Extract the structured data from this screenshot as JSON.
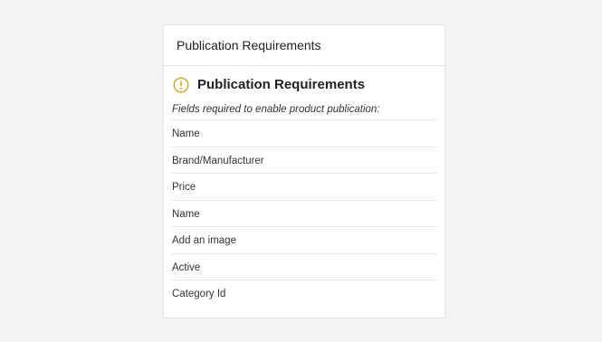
{
  "panel": {
    "header_title": "Publication Requirements",
    "section_title": "Publication Requirements",
    "subtitle": "Fields required to enable product publication:",
    "icon": "warning-circle-icon",
    "accent_color": "#d9a21b"
  },
  "requirements": [
    {
      "label": "Name"
    },
    {
      "label": "Brand/Manufacturer"
    },
    {
      "label": "Price"
    },
    {
      "label": "Name"
    },
    {
      "label": "Add an image"
    },
    {
      "label": "Active"
    },
    {
      "label": "Category Id"
    }
  ]
}
